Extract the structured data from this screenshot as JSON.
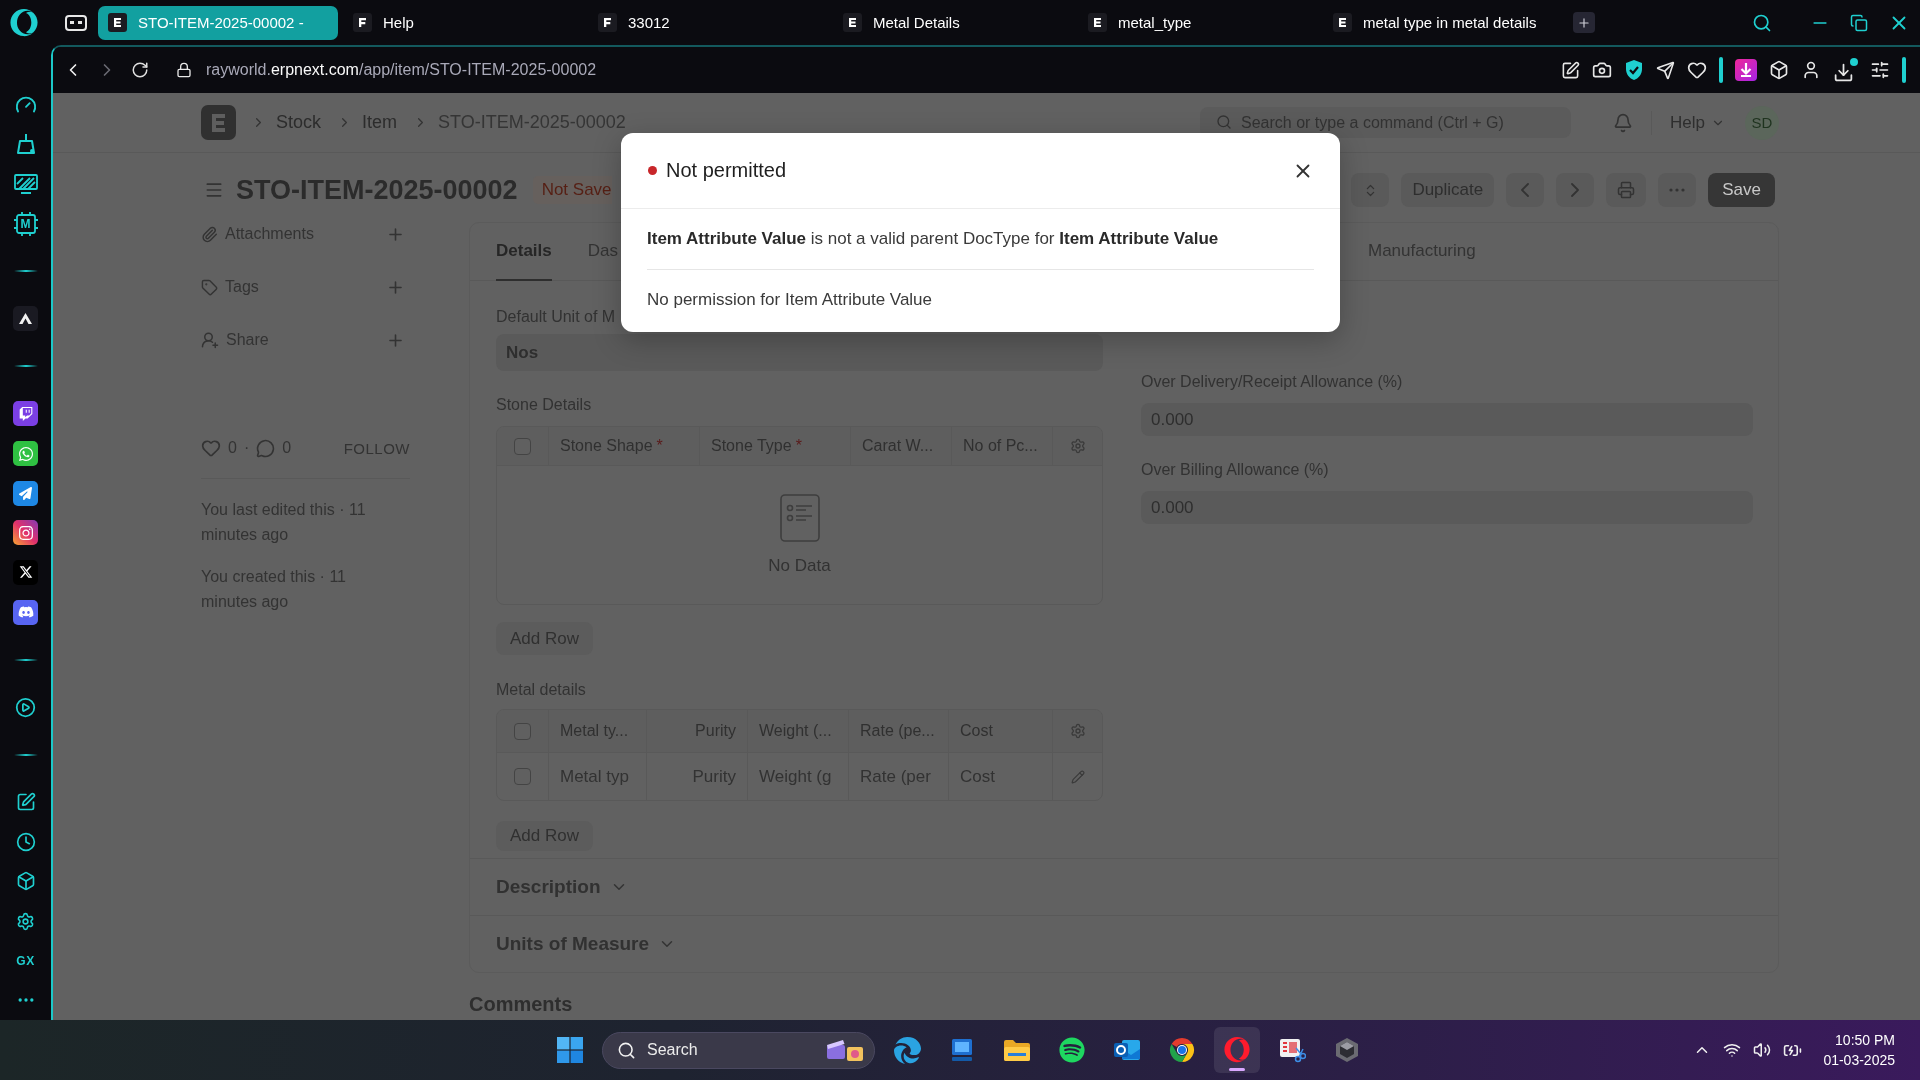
{
  "browser": {
    "tabs": [
      {
        "title": "STO-ITEM-2025-00002 -",
        "kind": "erpnext",
        "selected": true
      },
      {
        "title": "Help",
        "kind": "frappe",
        "selected": false
      },
      {
        "title": "33012",
        "kind": "frappe",
        "selected": false
      },
      {
        "title": "Metal Details",
        "kind": "erpnext",
        "selected": false
      },
      {
        "title": "metal_type",
        "kind": "erpnext",
        "selected": false
      },
      {
        "title": "metal type in metal details",
        "kind": "erpnext",
        "selected": false
      }
    ],
    "address": {
      "subdomain": "rayworld.",
      "domain": "erpnext.com",
      "path": "/app/item/STO-ITEM-2025-00002"
    }
  },
  "browser_sidebar": {
    "items": [
      {
        "kind": "gauge"
      },
      {
        "kind": "broom"
      },
      {
        "kind": "monitor"
      },
      {
        "kind": "chip",
        "label": "M"
      },
      {
        "kind": "divider"
      },
      {
        "kind": "peak"
      },
      {
        "kind": "divider"
      },
      {
        "kind": "twitch"
      },
      {
        "kind": "whatsapp"
      },
      {
        "kind": "telegram"
      },
      {
        "kind": "instagram"
      },
      {
        "kind": "x"
      },
      {
        "kind": "discord"
      },
      {
        "kind": "divider"
      },
      {
        "kind": "play"
      },
      {
        "kind": "divider"
      },
      {
        "kind": "edit"
      },
      {
        "kind": "clock"
      },
      {
        "kind": "cube"
      },
      {
        "kind": "gear"
      },
      {
        "kind": "text",
        "label": "GX"
      },
      {
        "kind": "more"
      }
    ]
  },
  "navbar": {
    "breadcrumbs": [
      "Stock",
      "Item",
      "STO-ITEM-2025-00002"
    ],
    "search": {
      "placeholder": "Search or type a command (Ctrl + G)"
    },
    "help": "Help",
    "avatar": "SD"
  },
  "page_head": {
    "title": "STO-ITEM-2025-00002",
    "status": "Not Save",
    "actions": [
      "Duplicate"
    ],
    "primary_action": "Save"
  },
  "form_sidebar": {
    "items": [
      {
        "label": "Attachments",
        "kind": "attachments"
      },
      {
        "label": "Tags",
        "kind": "tags"
      },
      {
        "label": "Share",
        "kind": "share"
      }
    ],
    "likes": "0",
    "separator": "·",
    "comments": "0",
    "follow": "FOLLOW",
    "activity": [
      "You last edited this · 11 minutes ago",
      "You created this · 11 minutes ago"
    ]
  },
  "form": {
    "tabs": [
      {
        "label": "Details",
        "selected": true
      },
      {
        "label": "Das",
        "selected": false
      },
      {
        "label": "Manufacturing",
        "selected": false
      }
    ],
    "default_uom": {
      "label": "Default Unit of M",
      "value": "Nos"
    },
    "stone_details": {
      "label": "Stone Details",
      "select_all": {
        "checked": false
      },
      "columns": [
        {
          "label": "Stone Shape",
          "mark": "*"
        },
        {
          "label": "Stone Type",
          "mark": "*"
        },
        {
          "label": "Carat W..."
        },
        {
          "label": "No of Pc..."
        }
      ],
      "empty_text": "No Data",
      "add_row": "Add Row"
    },
    "metal_details": {
      "label": "Metal details",
      "select_all": {
        "checked": false
      },
      "columns": [
        {
          "label": "Metal ty...",
          "kind": "text"
        },
        {
          "label": "Purity",
          "kind": "number"
        },
        {
          "label": "Weight (...",
          "kind": "text"
        },
        {
          "label": "Rate (pe...",
          "kind": "text"
        },
        {
          "label": "Cost",
          "kind": "text"
        }
      ],
      "rows": [
        {
          "checked": false,
          "cells": [
            {
              "placeholder": "Metal typ"
            },
            {
              "placeholder": "Purity"
            },
            {
              "placeholder": "Weight (g"
            },
            {
              "placeholder": "Rate (per"
            },
            {
              "placeholder": "Cost"
            }
          ]
        }
      ],
      "add_row": "Add Row"
    },
    "allowances": [
      {
        "label": "Over Delivery/Receipt Allowance (%)",
        "value": "0.000"
      },
      {
        "label": "Over Billing Allowance (%)",
        "value": "0.000"
      }
    ],
    "sections": [
      {
        "title": "Description",
        "expanded": false
      },
      {
        "title": "Units of Measure",
        "expanded": false
      }
    ]
  },
  "comments_heading": "Comments",
  "dialog": {
    "title": "Not permitted",
    "messages": [
      "**Item Attribute Value** is not a valid parent DocType for **Item Attribute Value**",
      "No permission for Item Attribute Value"
    ]
  },
  "taskbar": {
    "search": {
      "placeholder": "Search"
    },
    "apps": [
      {
        "kind": "edge",
        "selected": false
      },
      {
        "kind": "panel",
        "selected": false
      },
      {
        "kind": "folder",
        "selected": false
      },
      {
        "kind": "spotify",
        "selected": false
      },
      {
        "kind": "outlook",
        "selected": false
      },
      {
        "kind": "chrome",
        "selected": false
      },
      {
        "kind": "opera",
        "selected": true
      },
      {
        "kind": "snipping",
        "selected": false
      },
      {
        "kind": "hexagon",
        "selected": false
      }
    ],
    "time": "10:50 PM",
    "date": "01-03-2025"
  }
}
